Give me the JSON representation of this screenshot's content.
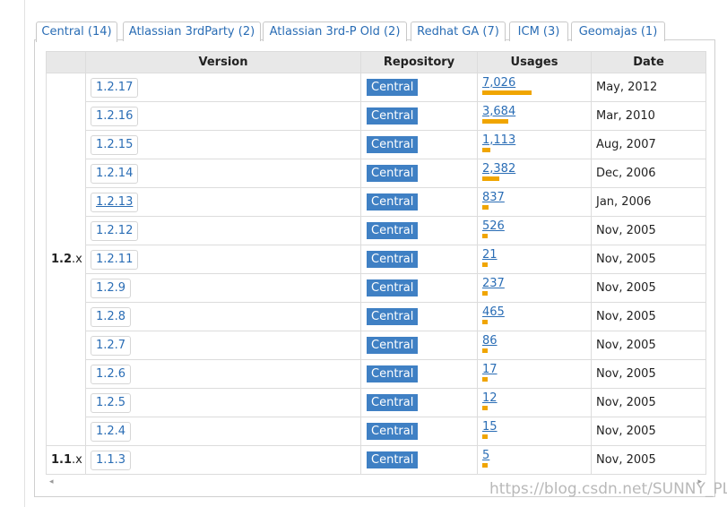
{
  "tabs": [
    {
      "label": "Central (14)",
      "active": true
    },
    {
      "label": "Atlassian 3rdParty (2)",
      "active": false
    },
    {
      "label": "Atlassian 3rd-P Old (2)",
      "active": false
    },
    {
      "label": "Redhat GA (7)",
      "active": false
    },
    {
      "label": "ICM (3)",
      "active": false
    },
    {
      "label": "Geomajas (1)",
      "active": false
    }
  ],
  "columns": {
    "version": "Version",
    "repository": "Repository",
    "usages": "Usages",
    "date": "Date"
  },
  "branches": [
    {
      "major": "1.2",
      "suffix": ".x"
    },
    {
      "major": "1.1",
      "suffix": ".x"
    }
  ],
  "rows": [
    {
      "version": "1.2.17",
      "repo": "Central",
      "usages": "7,026",
      "usage_fraction": 1.0,
      "date": "May, 2012"
    },
    {
      "version": "1.2.16",
      "repo": "Central",
      "usages": "3,684",
      "usage_fraction": 0.524,
      "date": "Mar, 2010"
    },
    {
      "version": "1.2.15",
      "repo": "Central",
      "usages": "1,113",
      "usage_fraction": 0.158,
      "date": "Aug, 2007"
    },
    {
      "version": "1.2.14",
      "repo": "Central",
      "usages": "2,382",
      "usage_fraction": 0.339,
      "date": "Dec, 2006"
    },
    {
      "version": "1.2.13",
      "repo": "Central",
      "usages": "837",
      "usage_fraction": 0.119,
      "date": "Jan, 2006"
    },
    {
      "version": "1.2.12",
      "repo": "Central",
      "usages": "526",
      "usage_fraction": 0.075,
      "date": "Nov, 2005"
    },
    {
      "version": "1.2.11",
      "repo": "Central",
      "usages": "21",
      "usage_fraction": 0.003,
      "date": "Nov, 2005"
    },
    {
      "version": "1.2.9",
      "repo": "Central",
      "usages": "237",
      "usage_fraction": 0.034,
      "date": "Nov, 2005"
    },
    {
      "version": "1.2.8",
      "repo": "Central",
      "usages": "465",
      "usage_fraction": 0.066,
      "date": "Nov, 2005"
    },
    {
      "version": "1.2.7",
      "repo": "Central",
      "usages": "86",
      "usage_fraction": 0.012,
      "date": "Nov, 2005"
    },
    {
      "version": "1.2.6",
      "repo": "Central",
      "usages": "17",
      "usage_fraction": 0.002,
      "date": "Nov, 2005"
    },
    {
      "version": "1.2.5",
      "repo": "Central",
      "usages": "12",
      "usage_fraction": 0.002,
      "date": "Nov, 2005"
    },
    {
      "version": "1.2.4",
      "repo": "Central",
      "usages": "15",
      "usage_fraction": 0.002,
      "date": "Nov, 2005"
    },
    {
      "version": "1.1.3",
      "repo": "Central",
      "usages": "5",
      "usage_fraction": 0.001,
      "date": "Nov, 2005"
    }
  ],
  "scroll_arrows": {
    "left": "◂",
    "right": "▸"
  },
  "watermark": "https://blog.csdn.net/SUNNY_PLAY",
  "colors": {
    "link": "#2a6db5",
    "repo_badge": "#3f80c4",
    "usage_bar": "#f0a500",
    "header_bg": "#e8e8e8"
  }
}
